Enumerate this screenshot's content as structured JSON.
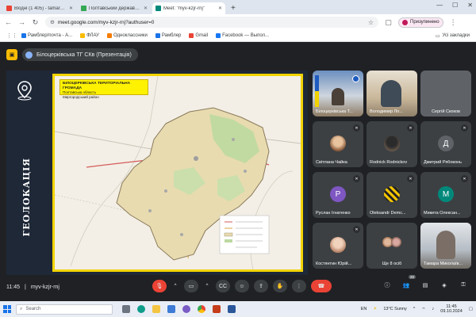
{
  "browser": {
    "tabs": [
      {
        "title": "Вхідні (1 405) - tamara.kozyrol...",
        "fav": "#ea4335"
      },
      {
        "title": "Полтавський державний агр...",
        "fav": "#34a853"
      },
      {
        "title": "Meet: \"myv-kzjr-rnj\"",
        "fav": "#00897b"
      }
    ],
    "url": "meet.google.com/myv-kzjr-rnj?authuser=0",
    "profile_label": "Призупинено",
    "bookmarks": [
      {
        "label": "Рамблер/почта - А...",
        "fav": "#1a73e8"
      },
      {
        "label": "ФЛАУ",
        "fav": "#fbbc04"
      },
      {
        "label": "Одноклассники",
        "fav": "#f57c00"
      },
      {
        "label": "Рамблер",
        "fav": "#1a73e8"
      },
      {
        "label": "Gmail",
        "fav": "#ea4335"
      },
      {
        "label": "Facebook — Выпол...",
        "fav": "#1877f2"
      }
    ],
    "all_bookmarks": "Усі закладки"
  },
  "meet": {
    "presentation_title": "Білоцерківська ТГ СКв (Презентація)",
    "slide": {
      "side_title": "ГЕОЛОКАЦІЯ",
      "map_title": "БІЛОЦЕРКІВСЬКА ТЕРИТОРІАЛЬНА ГРОМАДА",
      "map_sub1": "Полтавська область",
      "map_sub2": "Миргородський район"
    },
    "participants": [
      {
        "name": "Білоцерківська Т...",
        "type": "video",
        "color": "#6b8fbf"
      },
      {
        "name": "Володимир Ло...",
        "type": "video",
        "color": "#c9b79a"
      },
      {
        "name": "Сергій Скоков",
        "type": "none",
        "color": "#3c4043"
      },
      {
        "name": "Світлана Чайка",
        "type": "photo",
        "color": "#d7a36f"
      },
      {
        "name": "Rodnick Rodnickov",
        "type": "photo",
        "color": "#5a4a3e"
      },
      {
        "name": "Дмитрий Рябоконь",
        "type": "letter",
        "letter": "Д",
        "color": "#5f6368"
      },
      {
        "name": "Руслан Ігнатенко",
        "type": "letter",
        "letter": "Р",
        "color": "#7e57c2"
      },
      {
        "name": "Oleksandr Demc...",
        "type": "photo",
        "color": "#f2c200"
      },
      {
        "name": "Микита Олексан...",
        "type": "letter",
        "letter": "М",
        "color": "#00897b"
      },
      {
        "name": "Костянтин Юрій...",
        "type": "photo",
        "color": "#b98468"
      },
      {
        "name": "Ще 8 осіб",
        "type": "group",
        "color": "#a77d6a"
      },
      {
        "name": "Тамара Миколаїв...",
        "type": "video",
        "color": "#b5bcc4"
      }
    ],
    "time": "11:45",
    "meeting_code": "myv-kzjr-rnj",
    "people_count": "20"
  },
  "taskbar": {
    "search_placeholder": "Search",
    "weather": "13°C Sunny",
    "lang": "EN",
    "clock_time": "11:45",
    "clock_date": "09.10.2024"
  }
}
